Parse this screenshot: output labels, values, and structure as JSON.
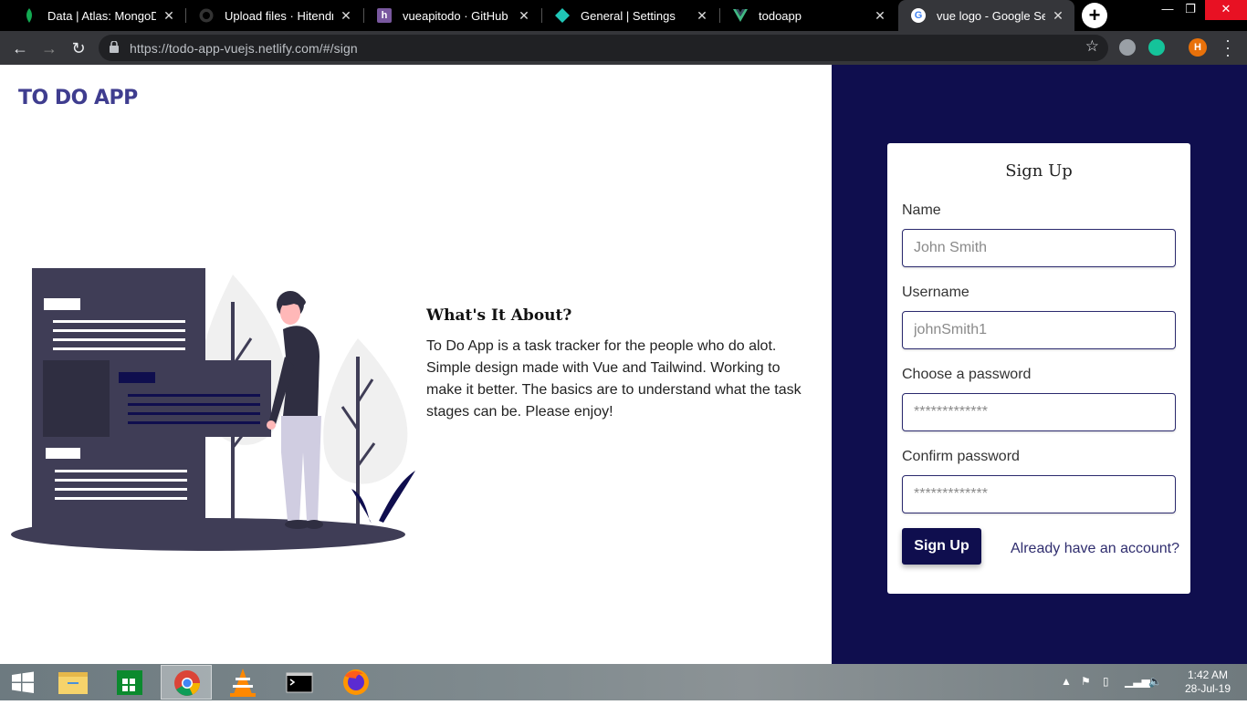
{
  "browser": {
    "tabs": [
      {
        "title": "Data | Atlas: MongoDB A",
        "icon": "mongodb-leaf-icon"
      },
      {
        "title": "Upload files · HitendraSi",
        "icon": "github-icon"
      },
      {
        "title": "vueapitodo · GitHub | He",
        "icon": "heroku-icon"
      },
      {
        "title": "General | Settings",
        "icon": "netlify-icon"
      },
      {
        "title": "todoapp",
        "icon": "vue-icon"
      },
      {
        "title": "vue logo - Google Searc",
        "icon": "google-icon"
      }
    ],
    "active_tab_index": 5,
    "url": "https://todo-app-vuejs.netlify.com/#/sign",
    "profile_initial": "H"
  },
  "app": {
    "brand": "TO DO APP",
    "about": {
      "title": "What's It About?",
      "text": "To Do App is a task tracker for the people who do alot. Simple design made with Vue and Tailwind. Working to make it better. The basics are to understand what the task stages can be. Please enjoy!"
    },
    "form": {
      "title": "Sign Up",
      "fields": [
        {
          "label": "Name",
          "placeholder": "John Smith"
        },
        {
          "label": "Username",
          "placeholder": "johnSmith1"
        },
        {
          "label": "Choose a password",
          "placeholder": "*************"
        },
        {
          "label": "Confirm password",
          "placeholder": "*************"
        }
      ],
      "submit_label": "Sign Up",
      "signin_link": "Already have an account?"
    }
  },
  "taskbar": {
    "apps": [
      "file-explorer-icon",
      "store-icon",
      "chrome-icon",
      "vlc-icon",
      "terminal-icon",
      "firefox-icon"
    ],
    "clock_time": "1:42 AM",
    "clock_date": "28-Jul-19"
  },
  "colors": {
    "brand": "#3f3d8f",
    "navy": "#0f0e4e",
    "chrome_dark": "#35363a"
  }
}
